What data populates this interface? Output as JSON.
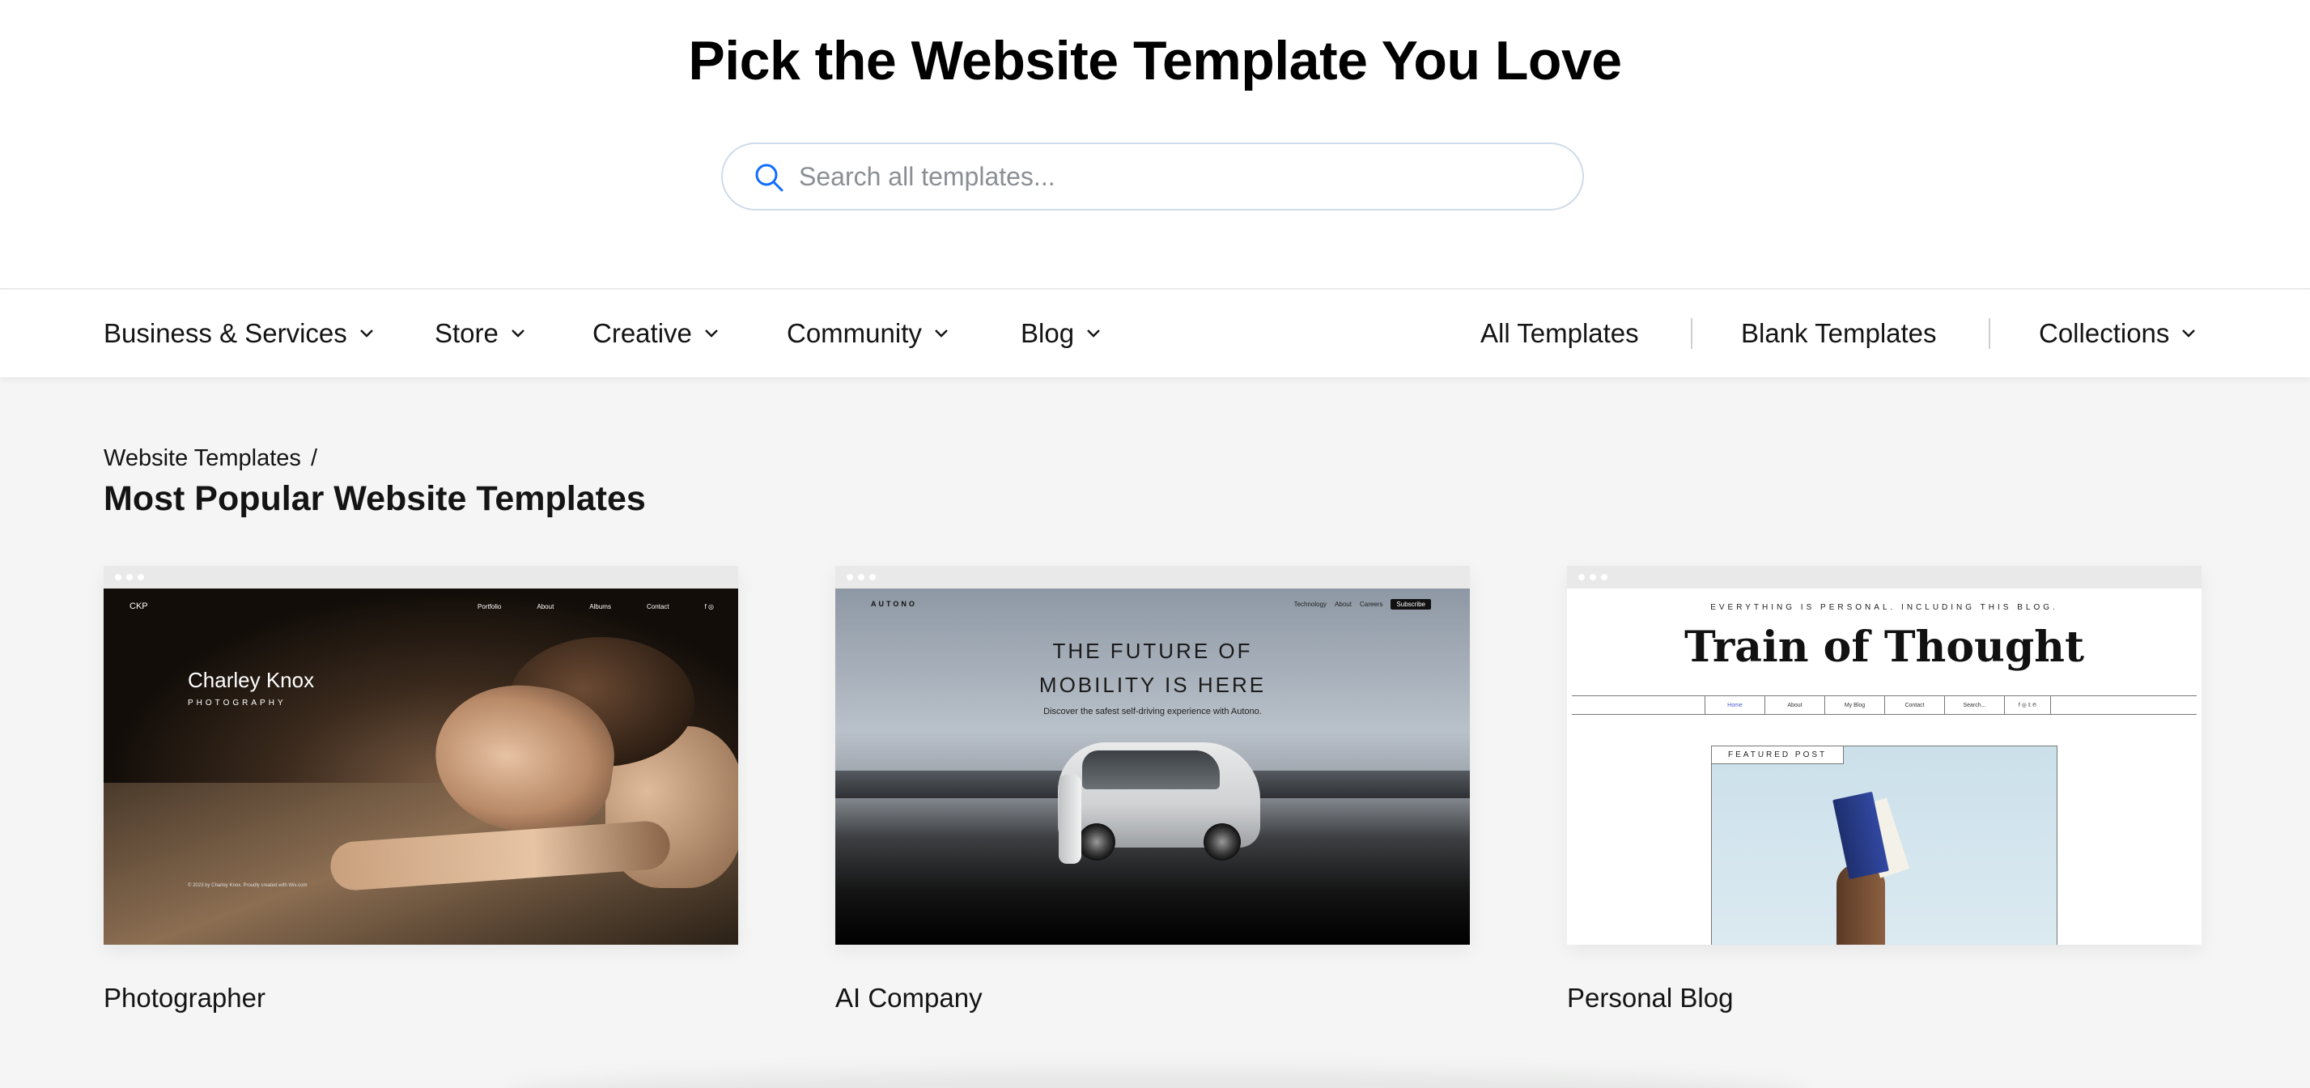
{
  "hero": {
    "title": "Pick the Website Template You Love",
    "search_placeholder": "Search all templates..."
  },
  "nav": {
    "left": [
      {
        "label": "Business & Services",
        "dropdown": true
      },
      {
        "label": "Store",
        "dropdown": true
      },
      {
        "label": "Creative",
        "dropdown": true
      },
      {
        "label": "Community",
        "dropdown": true
      },
      {
        "label": "Blog",
        "dropdown": true
      }
    ],
    "right": [
      {
        "label": "All Templates",
        "dropdown": false
      },
      {
        "label": "Blank Templates",
        "dropdown": false
      },
      {
        "label": "Collections",
        "dropdown": true
      }
    ]
  },
  "breadcrumb": {
    "root": "Website Templates",
    "separator": "/"
  },
  "page_title": "Most Popular Website Templates",
  "templates": [
    {
      "label": "Photographer",
      "preview": {
        "logo": "CKP",
        "nav": [
          "Portfolio",
          "About",
          "Albums",
          "Contact"
        ],
        "name": "Charley Knox",
        "subtitle": "PHOTOGRAPHY",
        "footer": "© 2023 by Charley Knox. Proudly created with Wix.com"
      }
    },
    {
      "label": "AI Company",
      "preview": {
        "logo": "AUTONO",
        "nav": [
          "Technology",
          "About",
          "Careers"
        ],
        "cta": "Subscribe",
        "headline": "THE FUTURE OF\nMOBILITY IS HERE",
        "tagline": "Discover the safest self-driving experience with Autono."
      }
    },
    {
      "label": "Personal Blog",
      "preview": {
        "tag": "EVERYTHING IS PERSONAL. INCLUDING THIS BLOG.",
        "title": "Train of Thought",
        "menu": [
          "Home",
          "About",
          "My Blog",
          "Contact",
          "Search..."
        ],
        "social": "f ◎ 𝕥 ℗",
        "featured": "FEATURED POST"
      }
    }
  ],
  "colors": {
    "page_bg": "#f4f5f4",
    "search_border": "#cfdbe9",
    "search_icon": "#116dff",
    "text": "#151414"
  }
}
